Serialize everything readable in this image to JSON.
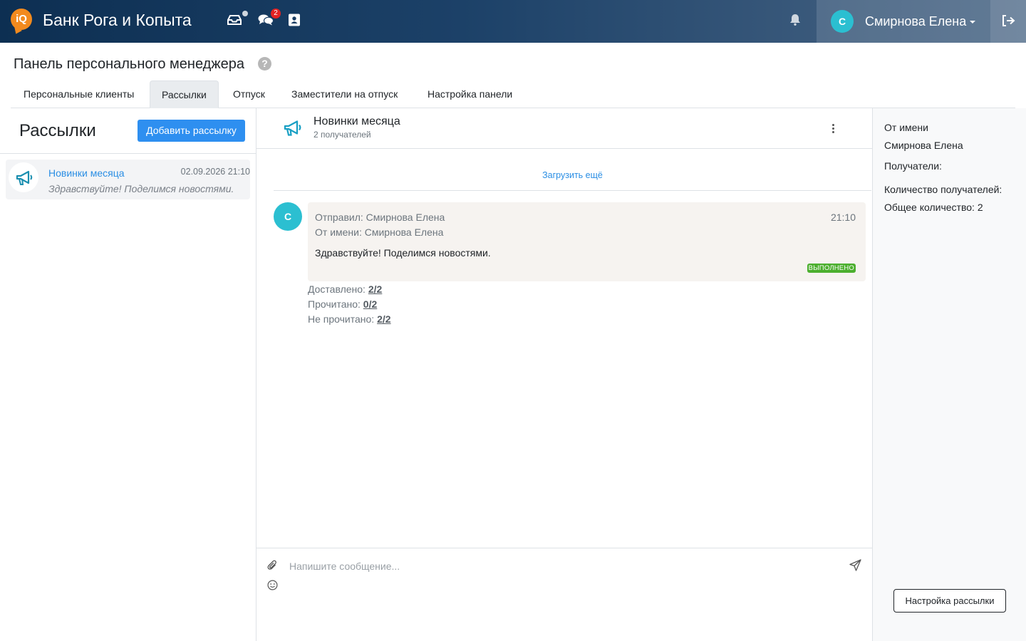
{
  "app": {
    "logo_text": "iQ",
    "brand": "Банк Рога и Копыта",
    "nav_icons": [
      "inbox-icon",
      "chats-icon",
      "contacts-icon"
    ],
    "chats_badge": "2",
    "notifications_icon": "bell-icon",
    "user": {
      "initial": "С",
      "name": "Смирнова Елена"
    },
    "logout_icon": "logout-icon"
  },
  "page": {
    "title": "Панель персонального менеджера",
    "help": "?",
    "tabs": [
      {
        "label": "Персональные клиенты",
        "active": false
      },
      {
        "label": "Рассылки",
        "active": true
      },
      {
        "label": "Отпуск",
        "active": false
      },
      {
        "label": "Заместители на отпуск",
        "active": false
      },
      {
        "label": "Настройка панели",
        "active": false
      }
    ]
  },
  "mailings": {
    "title": "Рассылки",
    "add_button": "Добавить рассылку",
    "items": [
      {
        "icon": "megaphone-icon",
        "title": "Новинки месяца",
        "date": "02.09.2026 21:10",
        "preview": "Здравствуйте! Поделимся новостями."
      }
    ]
  },
  "conversation": {
    "icon": "megaphone-icon",
    "title": "Новинки месяца",
    "subtitle": "2 получателей",
    "load_more": "Загрузить ещё",
    "message": {
      "avatar": "С",
      "sender": "Отправил: Смирнова Елена",
      "on_behalf": "От имени: Смирнова Елена",
      "time": "21:10",
      "text": "Здравствуйте! Поделимся новостями.",
      "status": "выполнено",
      "status_color": "#4caf2f",
      "delivered_label": "Доставлено:",
      "delivered_value": "2/2",
      "read_label": "Прочитано:",
      "read_value": "0/2",
      "unread_label": "Не прочитано:",
      "unread_value": "2/2"
    },
    "composer": {
      "placeholder": "Напишите сообщение...",
      "value": ""
    }
  },
  "details": {
    "from_label": "От имени",
    "from_value": "Смирнова Елена",
    "recipients_label": "Получатели:",
    "recipients_count_label": "Количество получателей:",
    "total_label": "Общее количество: 2",
    "settings_button": "Настройка рассылки"
  },
  "colors": {
    "accent": "#2e8ff0",
    "link": "#2a8ee4",
    "avatar": "#2bbfd1",
    "topbar": "#0d2f52",
    "badge": "#e32222"
  }
}
